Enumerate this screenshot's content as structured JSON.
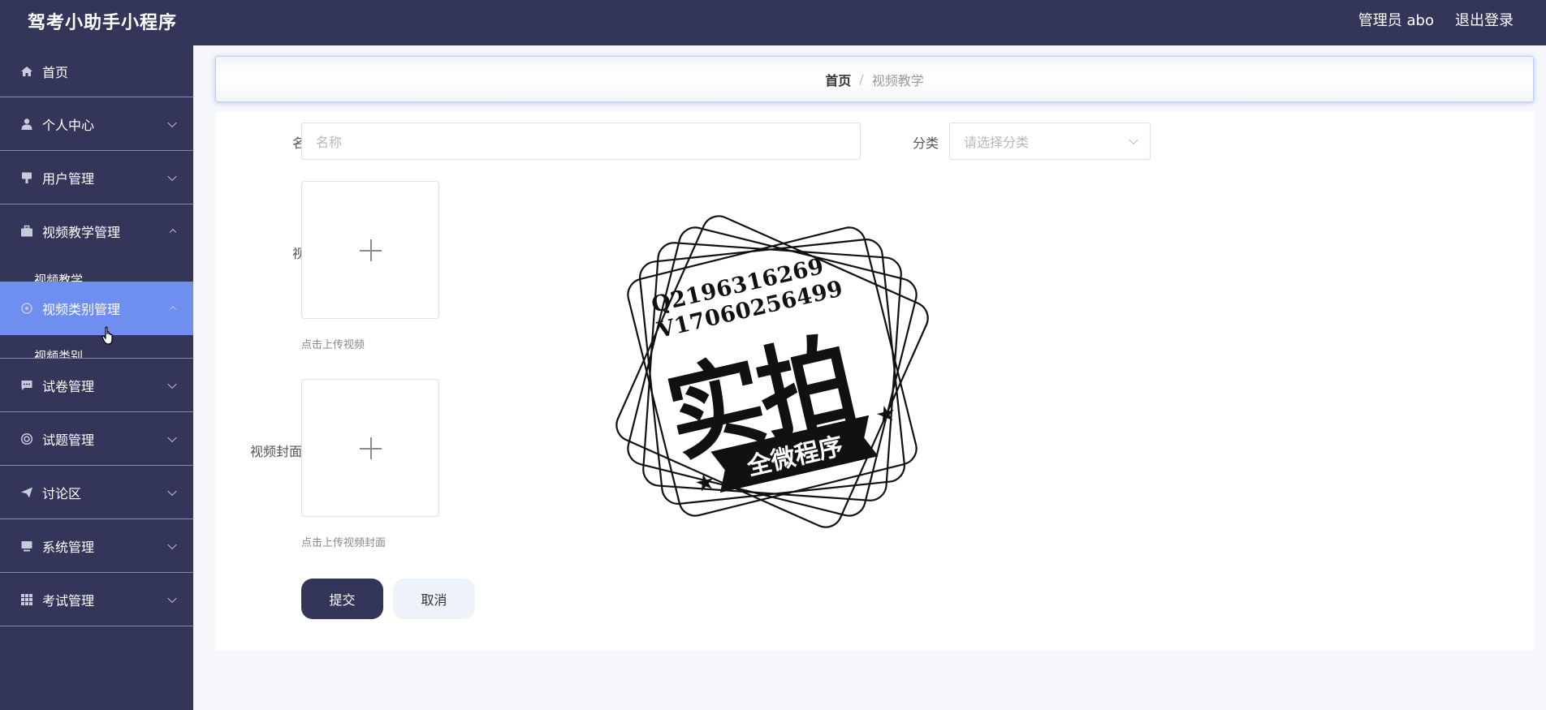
{
  "header": {
    "title": "驾考小助手小程序",
    "user_label": "管理员 abo",
    "logout_label": "退出登录"
  },
  "sidebar": {
    "items": [
      {
        "label": "首页",
        "icon": "home-icon"
      },
      {
        "label": "个人中心",
        "icon": "person-icon"
      },
      {
        "label": "用户管理",
        "icon": "user-manage-icon"
      },
      {
        "label": "视频教学管理",
        "icon": "briefcase-icon"
      },
      {
        "label": "视频类别管理",
        "icon": "circle-icon"
      },
      {
        "label": "试卷管理",
        "icon": "chat-icon"
      },
      {
        "label": "试题管理",
        "icon": "lifebuoy-icon"
      },
      {
        "label": "讨论区",
        "icon": "send-icon"
      },
      {
        "label": "系统管理",
        "icon": "monitor-icon"
      },
      {
        "label": "考试管理",
        "icon": "grid-icon"
      }
    ],
    "sub_items": {
      "video_teaching": "视频教学",
      "video_category": "视频类别"
    }
  },
  "breadcrumb": {
    "home": "首页",
    "separator": "/",
    "current": "视频教学"
  },
  "form": {
    "name_label": "名称",
    "name_placeholder": "名称",
    "category_label": "分类",
    "category_placeholder": "请选择分类",
    "video_label": "视频",
    "video_hint": "点击上传视频",
    "cover_label": "视频封面",
    "cover_hint": "点击上传视频封面",
    "submit_label": "提交",
    "cancel_label": "取消"
  },
  "watermark": {
    "line1": "Q2196316269",
    "line2": "V17060256499",
    "big_text": "实拍",
    "ribbon_text": "全微程序"
  },
  "colors": {
    "sidebar_bg": "#333659",
    "active_item": "#6e8ef0",
    "submit_bg": "#333659",
    "cancel_bg": "#edf2fb"
  }
}
